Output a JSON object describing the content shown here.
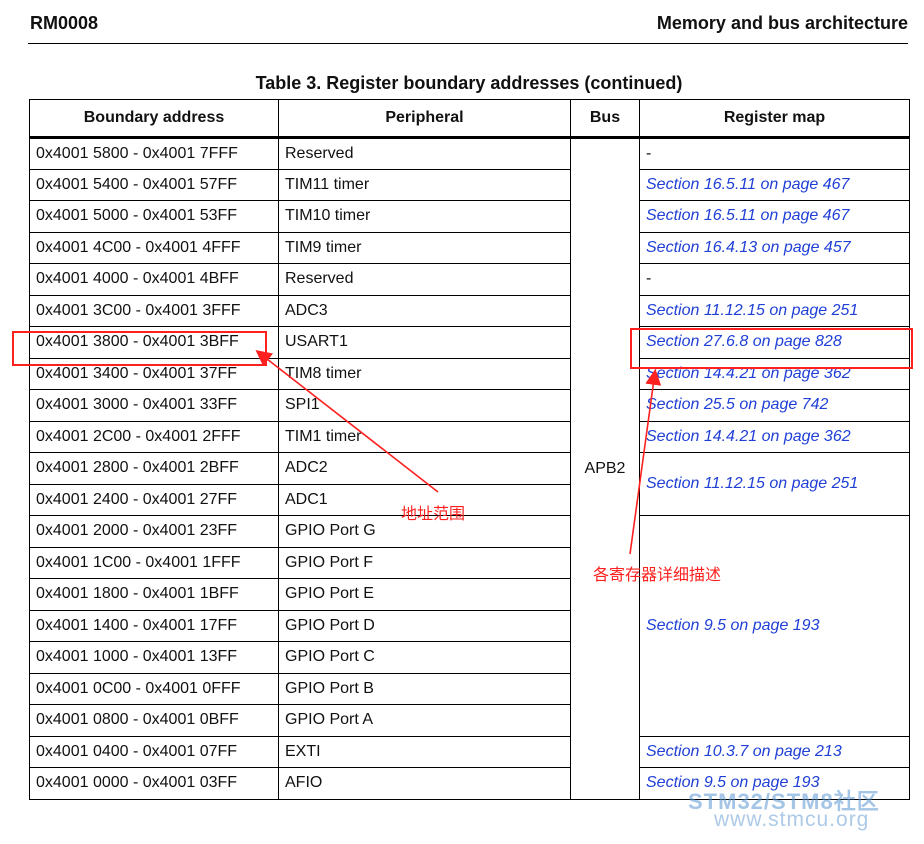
{
  "header": {
    "doc_id": "RM0008",
    "section_title": "Memory and bus architecture"
  },
  "table": {
    "caption": "Table 3. Register boundary addresses (continued)",
    "columns": [
      "Boundary address",
      "Peripheral",
      "Bus",
      "Register map"
    ],
    "bus_label": "APB2",
    "rows": [
      {
        "address": "0x4001 5800 - 0x4001 7FFF",
        "peripheral": "Reserved",
        "map": "-"
      },
      {
        "address": "0x4001 5400 - 0x4001 57FF",
        "peripheral": "TIM11 timer",
        "map": "Section 16.5.11 on page 467"
      },
      {
        "address": "0x4001 5000 - 0x4001 53FF",
        "peripheral": "TIM10 timer",
        "map": "Section 16.5.11 on page 467"
      },
      {
        "address": "0x4001 4C00 - 0x4001 4FFF",
        "peripheral": "TIM9 timer",
        "map": "Section 16.4.13 on page 457"
      },
      {
        "address": "0x4001 4000 - 0x4001 4BFF",
        "peripheral": "Reserved",
        "map": "-"
      },
      {
        "address": "0x4001 3C00 - 0x4001 3FFF",
        "peripheral": "ADC3",
        "map": "Section 11.12.15 on page 251"
      },
      {
        "address": "0x4001 3800 - 0x4001 3BFF",
        "peripheral": "USART1",
        "map": "Section 27.6.8 on page 828"
      },
      {
        "address": "0x4001 3400 - 0x4001 37FF",
        "peripheral": "TIM8 timer",
        "map": "Section 14.4.21 on page 362"
      },
      {
        "address": "0x4001 3000 - 0x4001 33FF",
        "peripheral": "SPI1",
        "map": "Section 25.5 on page 742"
      },
      {
        "address": "0x4001 2C00 - 0x4001 2FFF",
        "peripheral": "TIM1 timer",
        "map": "Section 14.4.21 on page 362"
      },
      {
        "address": "0x4001 2800 - 0x4001 2BFF",
        "peripheral": "ADC2",
        "map": "Section 11.12.15 on page 251"
      },
      {
        "address": "0x4001 2400 - 0x4001 27FF",
        "peripheral": "ADC1",
        "map": ""
      },
      {
        "address": "0x4001 2000 - 0x4001 23FF",
        "peripheral": "GPIO Port G",
        "map": "Section 9.5 on page 193"
      },
      {
        "address": "0x4001 1C00 - 0x4001 1FFF",
        "peripheral": "GPIO Port F",
        "map": ""
      },
      {
        "address": "0x4001 1800 - 0x4001 1BFF",
        "peripheral": "GPIO Port E",
        "map": ""
      },
      {
        "address": "0x4001 1400 - 0x4001 17FF",
        "peripheral": "GPIO Port D",
        "map": ""
      },
      {
        "address": "0x4001 1000 - 0x4001 13FF",
        "peripheral": "GPIO Port C",
        "map": ""
      },
      {
        "address": "0x4001 0C00 - 0x4001 0FFF",
        "peripheral": "GPIO Port B",
        "map": ""
      },
      {
        "address": "0x4001 0800 - 0x4001 0BFF",
        "peripheral": "GPIO Port A",
        "map": ""
      },
      {
        "address": "0x4001 0400 - 0x4001 07FF",
        "peripheral": "EXTI",
        "map": "Section 10.3.7 on page 213"
      },
      {
        "address": "0x4001 0000 - 0x4001 03FF",
        "peripheral": "AFIO",
        "map": "Section 9.5 on page 193"
      }
    ]
  },
  "annotations": {
    "address_range_label": "地址范围",
    "register_detail_label": "各寄存器详细描述",
    "color": "#ff2020"
  },
  "watermark": {
    "line1": "STM32/STM8社区",
    "line2": "www.stmcu.org"
  },
  "colors": {
    "link": "#1f3fd6"
  }
}
